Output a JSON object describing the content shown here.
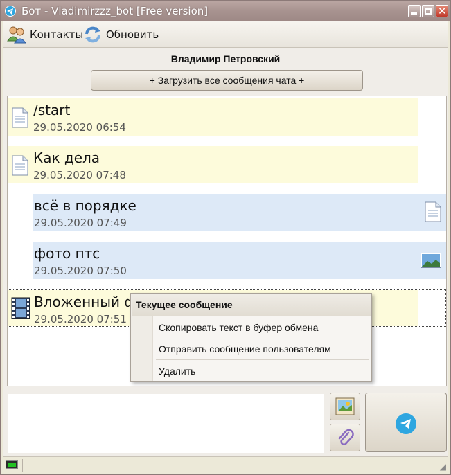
{
  "window": {
    "title": "Бот - Vladimirzzz_bot [Free version]"
  },
  "toolbar": {
    "contacts_label": "Контакты",
    "refresh_label": "Обновить"
  },
  "chat": {
    "contact_name": "Владимир Петровский",
    "load_all_label": "+ Загрузить все сообщения чата +"
  },
  "messages": [
    {
      "text": "/start",
      "time": "29.05.2020 06:54",
      "direction": "incoming",
      "icon": "document-icon"
    },
    {
      "text": "Как дела",
      "time": "29.05.2020 07:48",
      "direction": "incoming",
      "icon": "document-icon"
    },
    {
      "text": "всё в порядке",
      "time": "29.05.2020 07:49",
      "direction": "outgoing",
      "icon": "document-icon"
    },
    {
      "text": "фото птс",
      "time": "29.05.2020 07:50",
      "direction": "outgoing",
      "icon": "image-icon"
    },
    {
      "text": "Вложенный файл",
      "time": "29.05.2020 07:51",
      "direction": "incoming",
      "icon": "film-icon"
    }
  ],
  "context_menu": {
    "header": "Текущее сообщение",
    "items": [
      "Скопировать текст в буфер обмена",
      "Отправить сообщение пользователям",
      "Удалить"
    ]
  },
  "compose": {
    "value": ""
  },
  "colors": {
    "incoming_bg": "#fdfbdb",
    "outgoing_bg": "#dde9f7",
    "accent": "#2ea6e0"
  }
}
